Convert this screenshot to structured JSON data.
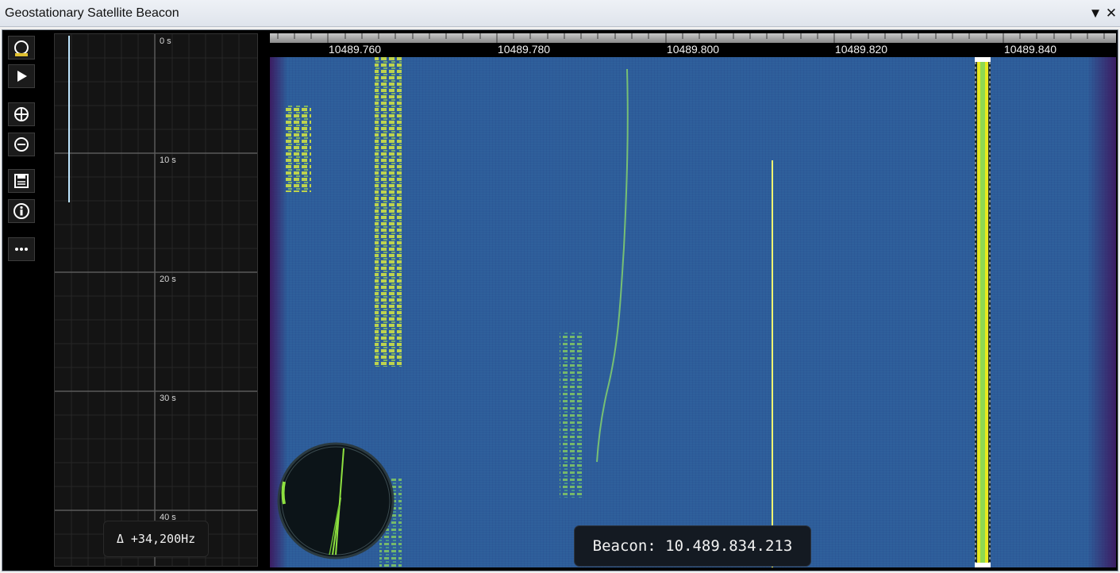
{
  "window": {
    "title": "Geostationary Satellite Beacon",
    "menu_icon": "dropdown-arrow-icon",
    "close_icon": "close-icon"
  },
  "toolbar": {
    "items": [
      {
        "icon": "circle-record-icon"
      },
      {
        "icon": "play-icon"
      },
      {
        "icon": "zoom-in-icon"
      },
      {
        "icon": "zoom-out-icon"
      },
      {
        "icon": "save-icon"
      },
      {
        "icon": "info-icon"
      },
      {
        "icon": "more-icon"
      }
    ]
  },
  "timeline": {
    "labels": [
      "0 s",
      "10 s",
      "20 s",
      "30 s",
      "40 s"
    ],
    "delta_readout": "Δ +34,200Hz"
  },
  "spectrum": {
    "frequency_labels": [
      "10489.760",
      "10489.780",
      "10489.800",
      "10489.820",
      "10489.840"
    ],
    "beacon_readout": "Beacon: 10.489.834.213"
  },
  "colors": {
    "waterfall_base": "#2d5d9a",
    "signal_yellow": "#f0f020",
    "signal_green": "#7fe05a",
    "edge_purple": "#3c195f"
  }
}
